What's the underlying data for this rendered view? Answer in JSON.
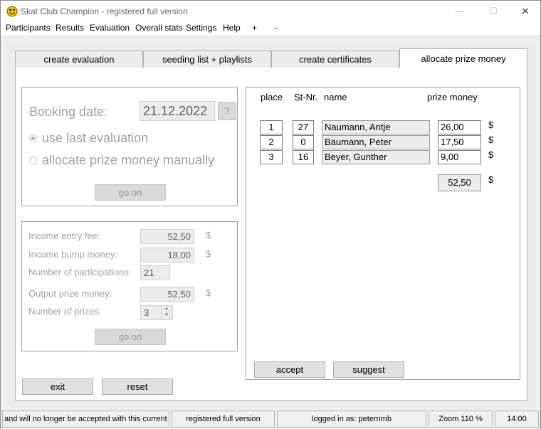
{
  "window": {
    "title": "Skat Club Champion - registered full version",
    "controls": {
      "minimize": "—",
      "maximize": "☐",
      "close": "✕"
    }
  },
  "menu": [
    "Participants",
    "Results",
    "Evaluation",
    "Overall stats",
    "Settings",
    "Help",
    "+",
    "-"
  ],
  "tabs": [
    "create evaluation",
    "seeding list + playlists",
    "create certificates",
    "allocate prize money"
  ],
  "booking": {
    "label": "Booking date:",
    "date": "21.12.2022",
    "help": "?",
    "radio_last": "use last evaluation",
    "radio_manual": "allocate prize money manually",
    "go_on": "go on"
  },
  "income": {
    "entry_fee_label": "Income entry fee:",
    "entry_fee": "52,50",
    "bump_label": "Income bump money:",
    "bump": "18,00",
    "participations_label": "Number of participations:",
    "participations": "21",
    "output_label": "Output prize money:",
    "output": "52,50",
    "prizes_label": "Number of prizes:",
    "prizes": "3",
    "currency": "$",
    "go_on": "go on"
  },
  "prize_table": {
    "headers": {
      "place": "place",
      "stnr": "St-Nr.",
      "name": "name",
      "money": "prize money"
    },
    "rows": [
      {
        "place": "1",
        "stnr": "27",
        "name": "Naumann, Antje",
        "money": "26,00"
      },
      {
        "place": "2",
        "stnr": "0",
        "name": "Baumann, Peter",
        "money": "17,50"
      },
      {
        "place": "3",
        "stnr": "16",
        "name": "Beyer, Gunther",
        "money": "9,00"
      }
    ],
    "total": "52,50",
    "currency": "$",
    "accept": "accept",
    "suggest": "suggest"
  },
  "bottom": {
    "exit": "exit",
    "reset": "reset"
  },
  "status": {
    "message": "and will no longer be accepted with this current versio",
    "license": "registered full version",
    "user": "logged in as: peternmb",
    "zoom": "Zoom 110 %",
    "time": "14:00"
  }
}
